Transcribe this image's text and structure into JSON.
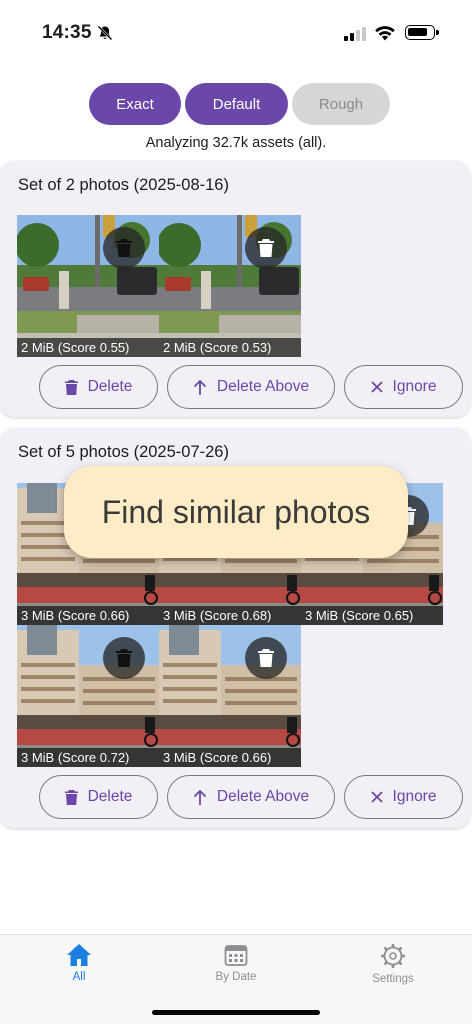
{
  "status_bar": {
    "time": "14:35"
  },
  "filters": {
    "options": [
      {
        "label": "Exact",
        "state": "selected"
      },
      {
        "label": "Default",
        "state": "selected"
      },
      {
        "label": "Rough",
        "state": "disabled"
      }
    ]
  },
  "analyzing_text": "Analyzing 32.7k assets (all).",
  "groups": [
    {
      "title": "Set of 2 photos (2025-08-16)",
      "photos": [
        {
          "caption": "2 MiB (Score 0.55)",
          "icon": "trash-icon"
        },
        {
          "caption": "2 MiB (Score 0.53)",
          "icon": "trash-icon"
        }
      ],
      "actions": {
        "delete": "Delete",
        "delete_above": "Delete Above",
        "ignore": "Ignore"
      }
    },
    {
      "title": "Set of 5 photos (2025-07-26)",
      "photos": [
        {
          "caption": "3 MiB (Score 0.66)",
          "icon": "trash-icon"
        },
        {
          "caption": "3 MiB (Score 0.68)",
          "icon": "trash-icon"
        },
        {
          "caption": "3 MiB (Score 0.65)",
          "icon": "trash-icon"
        },
        {
          "caption": "3 MiB (Score 0.72)",
          "icon": "trash-icon"
        },
        {
          "caption": "3 MiB (Score 0.66)",
          "icon": "trash-icon"
        }
      ],
      "actions": {
        "delete": "Delete",
        "delete_above": "Delete Above",
        "ignore": "Ignore"
      }
    }
  ],
  "toast": "Find similar photos",
  "nav": {
    "items": [
      {
        "label": "All",
        "icon": "home-icon",
        "active": true
      },
      {
        "label": "By Date",
        "icon": "calendar-icon",
        "active": false
      },
      {
        "label": "Settings",
        "icon": "gear-icon",
        "active": false
      }
    ]
  },
  "colors": {
    "accent": "#6a47a8",
    "nav_active": "#1b7fe0",
    "toast_bg": "#fdecc6",
    "card_bg": "#f2f0f6"
  }
}
